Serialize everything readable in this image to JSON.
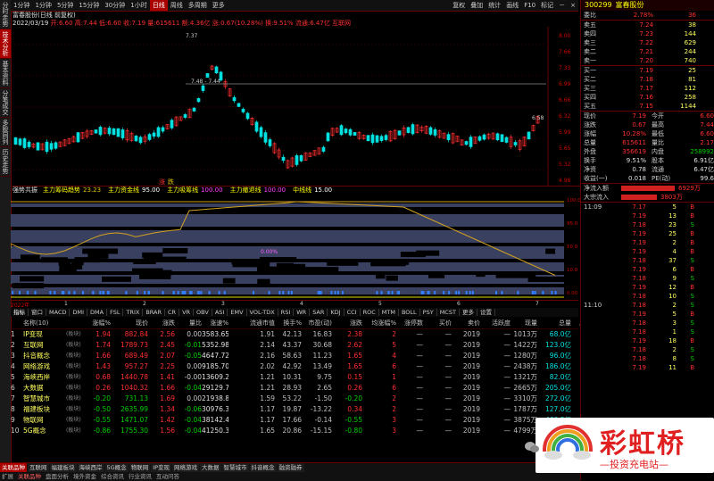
{
  "left_side_tabs": [
    {
      "label": "分时走势"
    },
    {
      "label": "技术分析"
    },
    {
      "label": "基本资料"
    },
    {
      "label": "分笔成交"
    },
    {
      "label": "多股同列"
    },
    {
      "label": "历史走势"
    }
  ],
  "top_toolbar": {
    "periods": [
      "1分钟",
      "1分钟",
      "5分钟",
      "15分钟",
      "30分钟",
      "1小时",
      "日线"
    ],
    "active_period": "日线",
    "extras": [
      "周线",
      "多周期",
      "更多"
    ],
    "right_buttons": [
      "复权",
      "叠加",
      "统计",
      "画线",
      "F10",
      "标记",
      "－",
      "×"
    ]
  },
  "chart_header": {
    "title": "富春股份(日线 前复权)",
    "date": "2022/03/19",
    "ohlc": "开:6.60 高:7.44 低:6.60 收:7.19 量:615611 额:4.36亿 涨:0.67(10.28%) 换:9.51% 流通:6.47亿 互联网",
    "price_labels": [
      "7.37",
      "7.48 - 7.44",
      "6.58"
    ],
    "axis_right": [
      "8.00",
      "7.66",
      "7.33",
      "6.99",
      "6.66",
      "6.32",
      "5.99",
      "5.65",
      "5.32",
      "4.98"
    ],
    "bottom_marks": [
      "涨",
      "跌"
    ]
  },
  "indicator": {
    "name": "强势共振",
    "items": [
      {
        "label": "主力筹码趋势",
        "value": "23.23"
      },
      {
        "label": "主力资金线",
        "value": "95.00"
      },
      {
        "label": "主力吸筹线",
        "value": "100.00"
      },
      {
        "label": "主力撤退线",
        "value": "100.00"
      },
      {
        "label": "中线线",
        "value": "15.00"
      }
    ],
    "pct_label": "0.00%",
    "axis_right": [
      "100.0",
      "95.0",
      "50.0",
      "10.0",
      "0.00"
    ]
  },
  "timeline": {
    "year": "2022年",
    "months": [
      "1",
      "2",
      "3",
      "4",
      "5",
      "6",
      "7"
    ],
    "right": "日线"
  },
  "indicator_tabs": [
    "指标",
    "窗口",
    "MACD",
    "DMI",
    "DMA",
    "FSL",
    "TRIX",
    "BRAR",
    "CR",
    "VR",
    "OBV",
    "ASI",
    "EMV",
    "VOL-TDX",
    "RSI",
    "WR",
    "SAR",
    "KDJ",
    "CCI",
    "ROC",
    "MTM",
    "BOLL",
    "PSY",
    "MCST",
    "更多",
    "设置"
  ],
  "table": {
    "headers": [
      "",
      "名称(10)",
      "",
      "涨幅%",
      "现价",
      "涨跌",
      "量比",
      "涨速%",
      "流通市值",
      "换手%",
      "市盈(动)",
      "涨跌",
      "均涨幅%",
      "涨停数",
      "买价",
      "卖价",
      "活跃度",
      "现量",
      "总量",
      "总金额"
    ],
    "rows": [
      [
        "1",
        "IP变现",
        "(板块)",
        "1.94",
        "882.84",
        "2.56",
        "0.00",
        "3583.65亿",
        "1.91",
        "42.13",
        "16.83",
        "2.38",
        "2",
        "—",
        "—",
        "2019",
        "—",
        "1013万",
        "68.0亿"
      ],
      [
        "2",
        "互联网",
        "(板块)",
        "1.74",
        "1789.73",
        "2.45",
        "-0.01",
        "5352.98亿",
        "2.14",
        "43.37",
        "30.68",
        "2.62",
        "5",
        "—",
        "—",
        "2019",
        "—",
        "1422万",
        "123.0亿"
      ],
      [
        "3",
        "抖音概念",
        "(板块)",
        "1.66",
        "689.49",
        "2.07",
        "-0.05",
        "4647.72亿",
        "2.16",
        "58.63",
        "11.23",
        "1.65",
        "4",
        "—",
        "—",
        "2019",
        "—",
        "1280万",
        "96.0亿"
      ],
      [
        "4",
        "网络游戏",
        "(板块)",
        "1.43",
        "957.27",
        "2.25",
        "0.00",
        "9185.70亿",
        "2.02",
        "42.92",
        "13.49",
        "1.65",
        "6",
        "—",
        "—",
        "2019",
        "—",
        "2438万",
        "186.0亿"
      ],
      [
        "5",
        "海峡西岸",
        "(板块)",
        "0.68",
        "1440.78",
        "1.41",
        "-0.00",
        "13609.25亿",
        "1.21",
        "10.31",
        "9.75",
        "0.15",
        "1",
        "—",
        "—",
        "2019",
        "—",
        "1321万",
        "82.0亿"
      ],
      [
        "6",
        "大数据",
        "(板块)",
        "0.26",
        "1040.32",
        "1.66",
        "-0.04",
        "29129.74亿",
        "1.21",
        "28.93",
        "2.65",
        "0.26",
        "6",
        "—",
        "—",
        "2019",
        "—",
        "2665万",
        "205.0亿"
      ],
      [
        "7",
        "智慧城市",
        "(板块)",
        "-0.20",
        "731.13",
        "1.69",
        "0.00",
        "21938.81亿",
        "1.59",
        "53.22",
        "-1.50",
        "-0.20",
        "2",
        "—",
        "—",
        "2019",
        "—",
        "3310万",
        "272.0亿"
      ],
      [
        "8",
        "福建板块",
        "(板块)",
        "-0.50",
        "2635.99",
        "1.34",
        "-0.06",
        "30976.37亿",
        "1.17",
        "19.87",
        "-13.22",
        "0.34",
        "2",
        "—",
        "—",
        "2019",
        "—",
        "1787万",
        "127.0亿"
      ],
      [
        "9",
        "物联网",
        "(板块)",
        "-0.55",
        "1471.07",
        "1.42",
        "-0.04",
        "38142.44亿",
        "1.17",
        "17.66",
        "-0.14",
        "-0.55",
        "3",
        "—",
        "—",
        "2019",
        "—",
        "3875万",
        "466.3亿"
      ],
      [
        "10",
        "5G概念",
        "(板块)",
        "-0.86",
        "1755.30",
        "1.56",
        "-0.04",
        "41250.32亿",
        "1.65",
        "20.86",
        "-15.15",
        "-0.80",
        "3",
        "—",
        "—",
        "2019",
        "—",
        "4799万",
        "—"
      ]
    ]
  },
  "bottom_tabs": [
    "关联品种",
    "互联网",
    "福建板块",
    "海峡西岸",
    "5G概念",
    "物联网",
    "IP变现",
    "网络游戏",
    "大数据",
    "智慧城市",
    "抖音概念",
    "融资融券"
  ],
  "status_bar": [
    "扩展",
    "关联品种",
    "盘面分析",
    "境外资金",
    "综合资讯",
    "行业资讯",
    "互动问答"
  ],
  "right_panel": {
    "code": "300299",
    "name": "富春股份",
    "ratio_label": "委比",
    "ratio_value": "2.78%",
    "diff_value": "36",
    "asks": [
      {
        "label": "卖五",
        "price": "7.24",
        "vol": "38"
      },
      {
        "label": "卖四",
        "price": "7.23",
        "vol": "144"
      },
      {
        "label": "卖三",
        "price": "7.22",
        "vol": "629"
      },
      {
        "label": "卖二",
        "price": "7.21",
        "vol": "244"
      },
      {
        "label": "卖一",
        "price": "7.20",
        "vol": "740"
      }
    ],
    "bids": [
      {
        "label": "买一",
        "price": "7.19",
        "vol": "25"
      },
      {
        "label": "买二",
        "price": "7.18",
        "vol": "81"
      },
      {
        "label": "买三",
        "price": "7.17",
        "vol": "112"
      },
      {
        "label": "买四",
        "price": "7.16",
        "vol": "258"
      },
      {
        "label": "买五",
        "price": "7.15",
        "vol": "1144"
      }
    ],
    "stats": [
      {
        "l1": "现价",
        "v1": "7.19",
        "l2": "今开",
        "v2": "6.60"
      },
      {
        "l1": "涨跌",
        "v1": "0.67",
        "l2": "最高",
        "v2": "7.44"
      },
      {
        "l1": "涨幅",
        "v1": "10.28%",
        "l2": "最低",
        "v2": "6.60"
      },
      {
        "l1": "总量",
        "v1": "615611",
        "l2": "量比",
        "v2": "2.17"
      },
      {
        "l1": "外盘",
        "v1": "356619",
        "l2": "内盘",
        "v2": "258992"
      },
      {
        "l1": "换手",
        "v1": "9.51%",
        "l2": "股本",
        "v2": "6.91亿"
      },
      {
        "l1": "净资",
        "v1": "0.78",
        "l2": "流通",
        "v2": "6.47亿"
      },
      {
        "l1": "收益(一)",
        "v1": "0.018",
        "l2": "PE(动)",
        "v2": "99.6"
      }
    ],
    "flows": [
      {
        "label": "净流入额",
        "value": "6929万"
      },
      {
        "label": "大宗流入",
        "value": "3803万"
      }
    ],
    "ticks": [
      {
        "time": "11:09",
        "price": "7.17",
        "vol": "5",
        "side": "B"
      },
      {
        "time": "",
        "price": "7.19",
        "vol": "13",
        "side": "B"
      },
      {
        "time": "",
        "price": "7.18",
        "vol": "23",
        "side": "S"
      },
      {
        "time": "",
        "price": "7.19",
        "vol": "25",
        "side": "B"
      },
      {
        "time": "",
        "price": "7.19",
        "vol": "2",
        "side": "B"
      },
      {
        "time": "",
        "price": "7.19",
        "vol": "4",
        "side": "B"
      },
      {
        "time": "",
        "price": "7.18",
        "vol": "37",
        "side": "S"
      },
      {
        "time": "",
        "price": "7.19",
        "vol": "6",
        "side": "B"
      },
      {
        "time": "",
        "price": "7.18",
        "vol": "9",
        "side": "S"
      },
      {
        "time": "",
        "price": "7.19",
        "vol": "12",
        "side": "B"
      },
      {
        "time": "",
        "price": "7.18",
        "vol": "10",
        "side": "S"
      },
      {
        "time": "11:10",
        "price": "7.18",
        "vol": "2",
        "side": "S"
      },
      {
        "time": "",
        "price": "7.19",
        "vol": "5",
        "side": "B"
      },
      {
        "time": "",
        "price": "7.18",
        "vol": "3",
        "side": "S"
      },
      {
        "time": "",
        "price": "7.18",
        "vol": "1",
        "side": "S"
      },
      {
        "time": "",
        "price": "7.19",
        "vol": "18",
        "side": "B"
      },
      {
        "time": "",
        "price": "7.18",
        "vol": "2",
        "side": "S"
      },
      {
        "time": "",
        "price": "7.18",
        "vol": "8",
        "side": "S"
      },
      {
        "time": "",
        "price": "7.19",
        "vol": "11",
        "side": "B"
      }
    ]
  },
  "watermark": {
    "title": "彩虹桥",
    "subtitle": "投资充电站"
  }
}
